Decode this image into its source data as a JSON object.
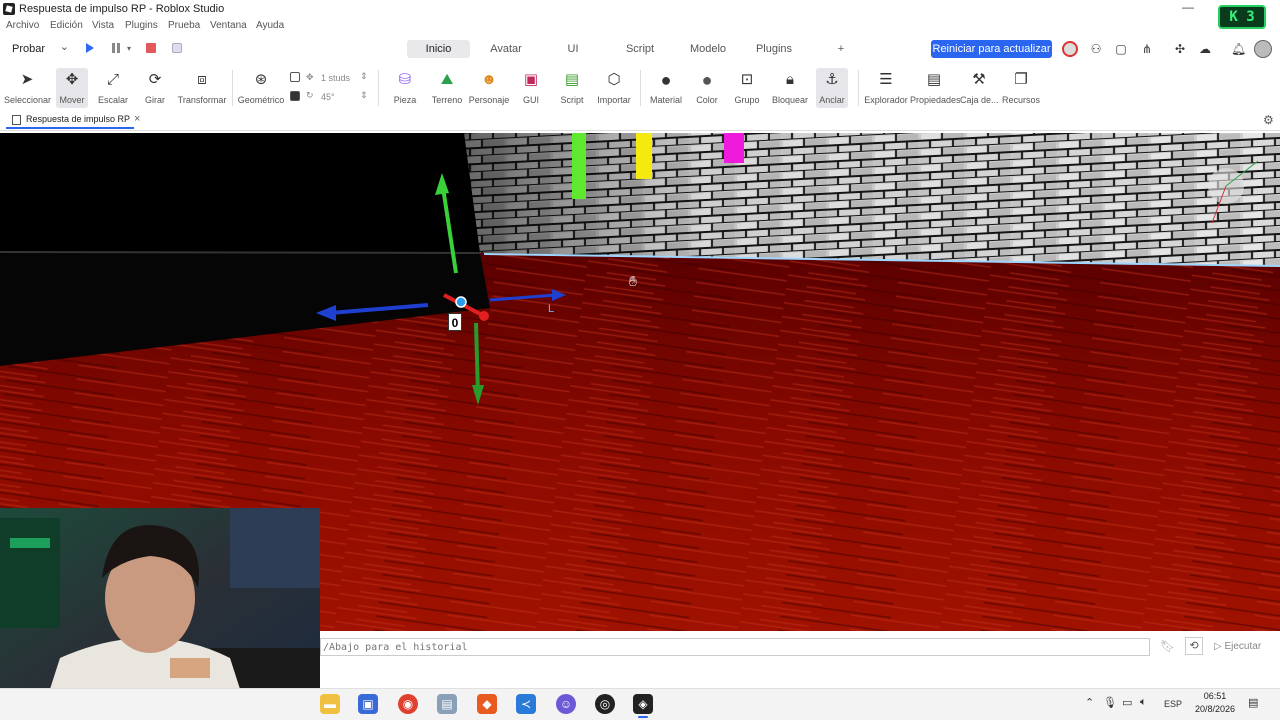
{
  "window": {
    "title": "Respuesta de impulso RP  - Roblox Studio",
    "badge": "3"
  },
  "menu": [
    "Archivo",
    "Edición",
    "Vista",
    "Plugins",
    "Prueba",
    "Ventana",
    "Ayuda"
  ],
  "run": {
    "mode_label": "Probar"
  },
  "tabs": {
    "items": [
      "Inicio",
      "Avatar",
      "UI",
      "Script",
      "Modelo",
      "Plugins",
      "+"
    ],
    "active": "Inicio"
  },
  "restart_label": "Reiniciar para actualizar",
  "toolbar": {
    "select": "Seleccionar",
    "move": "Mover",
    "scale": "Escalar",
    "rotate": "Girar",
    "transform": "Transformar",
    "geometric": "Geométrico",
    "snap_move": "1 studs",
    "snap_rotate": "45°",
    "part": "Pieza",
    "terrain": "Terreno",
    "character": "Personaje",
    "gui": "GUI",
    "script": "Script",
    "import": "Importar",
    "material": "Material",
    "color": "Color",
    "group": "Grupo",
    "lock": "Bloquear",
    "anchor": "Anclar",
    "explorer": "Explorador",
    "properties": "Propiedades",
    "toolbox": "Caja de...",
    "assets": "Recursos"
  },
  "document_tab": {
    "label": "Respuesta de impulso RP"
  },
  "viewport": {
    "marker_label": "0",
    "axis_label": "L"
  },
  "command_bar": {
    "placeholder": "/Abajo para el historial",
    "run_label": "Ejecutar"
  },
  "taskbar": {
    "language": "ESP",
    "time": "06:51",
    "date": "20/8/2026"
  },
  "colors": {
    "accent": "#2a66f0",
    "floor": "#8a0000",
    "brick": "#d8d8d8"
  }
}
